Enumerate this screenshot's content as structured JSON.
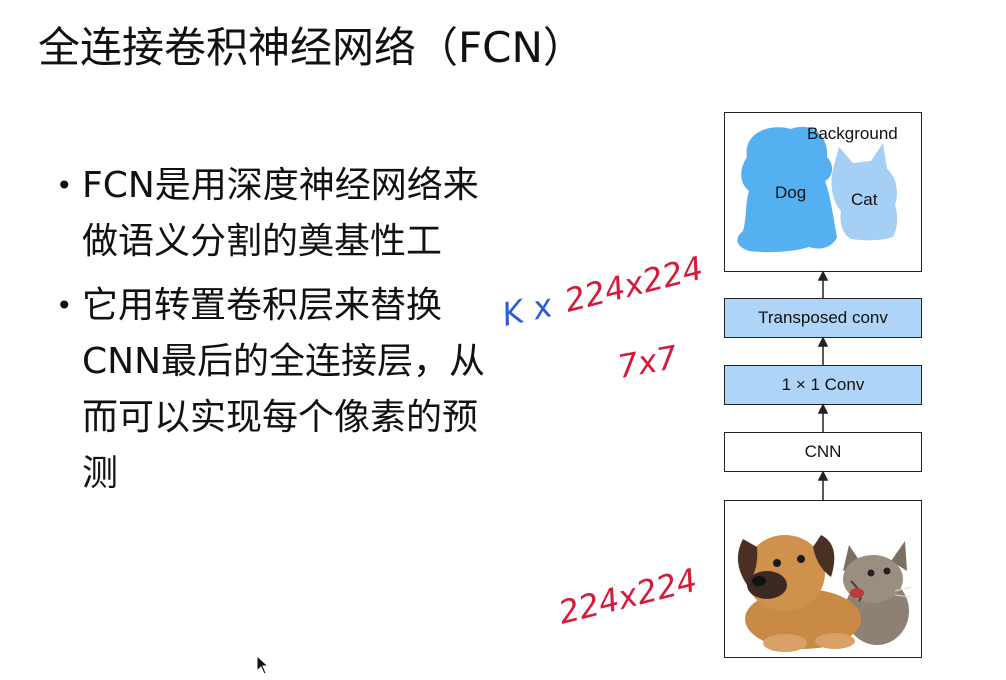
{
  "slide": {
    "title": "全连接卷积神经网络（FCN）",
    "bullets": [
      {
        "lines": [
          "FCN是用深度神经网络来",
          "做语义分割的奠基性工"
        ]
      },
      {
        "lines": [
          "它用转置卷积层来替换",
          "CNN最后的全连接层，从",
          "而可以实现每个像素的预",
          "测"
        ]
      }
    ],
    "bullet_glyph": "•"
  },
  "diagram": {
    "segmentation": {
      "background_label": "Background",
      "dog_label": "Dog",
      "cat_label": "Cat",
      "dog_color": "#55b0f2",
      "cat_color": "#a5cff5"
    },
    "transposed_conv_label": "Transposed conv",
    "conv1x1_label": "1 × 1 Conv",
    "cnn_label": "CNN"
  },
  "annotations": {
    "ink_red": "#d41b3a",
    "ink_blue": "#2a5ed6",
    "kx": "K x",
    "top_size": "224x224",
    "mid_size": "7x7",
    "bottom_size": "224x224"
  },
  "colors": {
    "box_blue": "#aed4f7",
    "border": "#222222"
  }
}
